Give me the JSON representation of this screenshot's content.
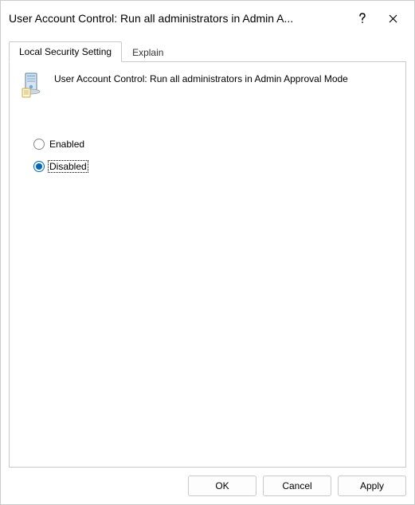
{
  "window": {
    "title": "User Account Control: Run all administrators in Admin A..."
  },
  "tabs": {
    "local_security_setting": "Local Security Setting",
    "explain": "Explain"
  },
  "policy": {
    "title": "User Account Control: Run all administrators in Admin Approval Mode"
  },
  "options": {
    "enabled": {
      "label": "Enabled",
      "checked": false
    },
    "disabled": {
      "label": "Disabled",
      "checked": true
    }
  },
  "buttons": {
    "ok": "OK",
    "cancel": "Cancel",
    "apply": "Apply"
  }
}
